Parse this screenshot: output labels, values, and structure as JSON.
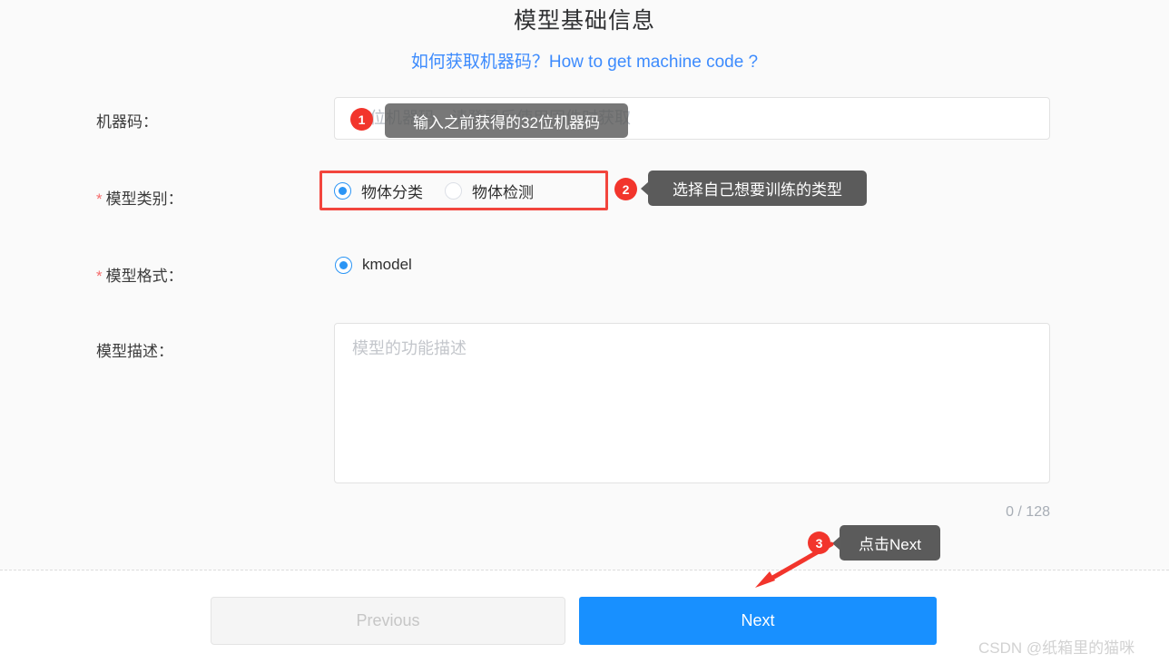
{
  "header": {
    "title": "模型基础信息",
    "help_link": "如何获取机器码？How to get machine code ?"
  },
  "form": {
    "machine_code": {
      "label": "机器码：",
      "placeholder": "32位机器码，请登录后使用固件时获取",
      "value": ""
    },
    "model_category": {
      "label": "模型类别：",
      "required_mark": "*",
      "options": [
        {
          "label": "物体分类",
          "checked": true
        },
        {
          "label": "物体检测",
          "checked": false
        }
      ]
    },
    "model_format": {
      "label": "模型格式：",
      "required_mark": "*",
      "options": [
        {
          "label": "kmodel",
          "checked": true
        }
      ]
    },
    "model_description": {
      "label": "模型描述：",
      "placeholder": "模型的功能描述",
      "value": "",
      "counter": "0 / 128"
    }
  },
  "callouts": [
    {
      "number": "1",
      "text": "输入之前获得的32位机器码"
    },
    {
      "number": "2",
      "text": "选择自己想要训练的类型"
    },
    {
      "number": "3",
      "text": "点击Next"
    }
  ],
  "footer": {
    "previous_label": "Previous",
    "next_label": "Next"
  },
  "watermark": "CSDN @纸箱里的猫咪",
  "colors": {
    "primary_blue": "#1890ff",
    "link_blue": "#3d8bfd",
    "badge_red": "#f2352c",
    "highlight_red": "#f2453d",
    "required_star": "#f56c6c",
    "callout_gray": "#5d5d5d",
    "panel_bg": "#fafafa"
  }
}
